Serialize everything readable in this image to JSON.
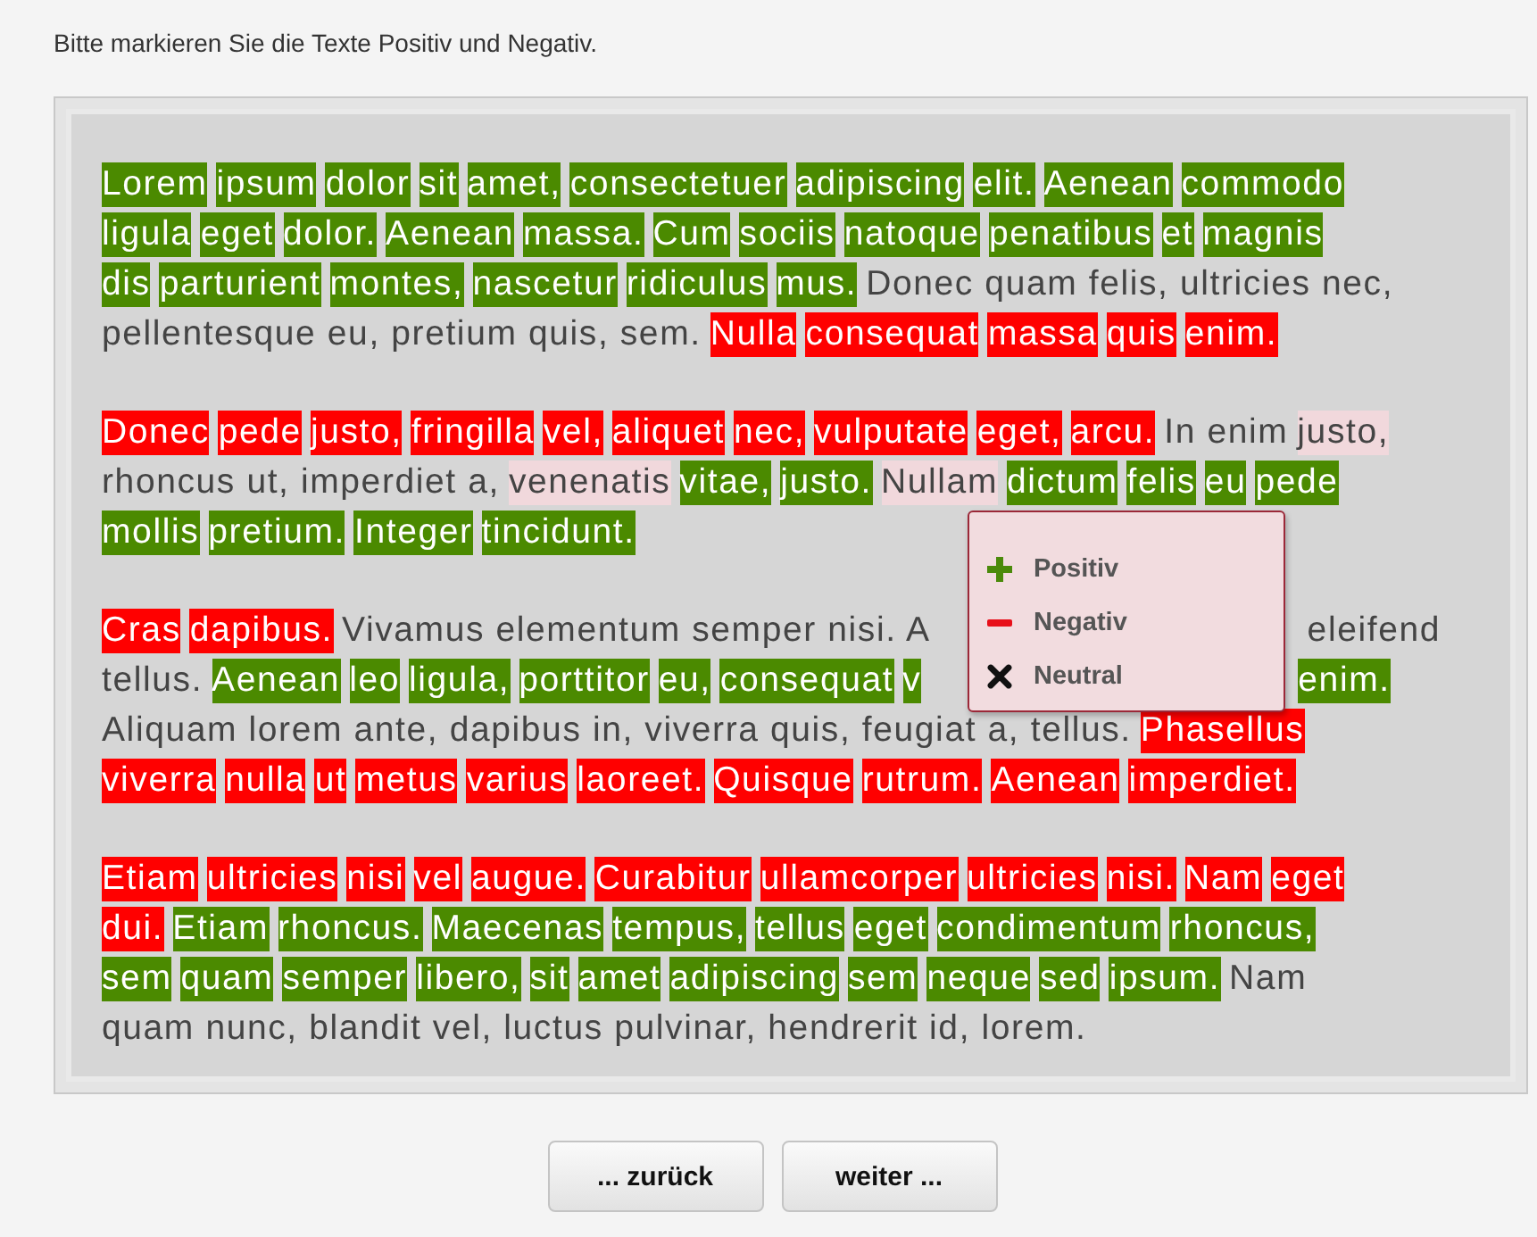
{
  "instruction": "Bitte markieren Sie die Texte Positiv und Negativ.",
  "paragraphs": [
    [
      [
        {
          "text": "Lorem ipsum dolor sit amet, consectetuer adipiscing elit. Aenean commodo",
          "kind": "positive"
        }
      ],
      [
        {
          "text": "ligula eget dolor. Aenean massa. Cum sociis natoque penatibus et magnis",
          "kind": "positive"
        }
      ],
      [
        {
          "text": "dis parturient montes, nascetur ridiculus mus.",
          "kind": "positive"
        },
        {
          "text": "Donec quam felis, ultricies nec,",
          "kind": "neutral"
        }
      ],
      [
        {
          "text": "pellentesque eu, pretium quis, sem.",
          "kind": "neutral"
        },
        {
          "text": "Nulla consequat massa quis enim.",
          "kind": "negative"
        }
      ]
    ],
    [
      [
        {
          "text": "Donec pede justo, fringilla vel, aliquet nec, vulputate eget, arcu.",
          "kind": "negative"
        },
        {
          "text": "In enim",
          "kind": "neutral"
        },
        {
          "text": "justo,",
          "kind": "pending"
        }
      ],
      [
        {
          "text": "rhoncus ut, imperdiet a,",
          "kind": "neutral"
        },
        {
          "text": "venenatis",
          "kind": "pending"
        },
        {
          "text": "vitae, justo.",
          "kind": "positive"
        },
        {
          "text": "Nullam",
          "kind": "pending"
        },
        {
          "text": "dictum felis eu pede",
          "kind": "positive"
        }
      ],
      [
        {
          "text": "mollis pretium. Integer tincidunt.",
          "kind": "positive"
        }
      ]
    ],
    [
      [
        {
          "text": "Cras dapibus.",
          "kind": "negative"
        },
        {
          "text": "Vivamus elementum semper nisi. A",
          "kind": "neutral",
          "covered_after": true
        },
        {
          "text": "eleifend",
          "kind": "neutral"
        }
      ],
      [
        {
          "text": "tellus.",
          "kind": "neutral"
        },
        {
          "text": "Aenean leo ligula, porttitor eu, consequat v",
          "kind": "positive",
          "covered_after": true
        },
        {
          "text": "enim.",
          "kind": "positive"
        }
      ],
      [
        {
          "text": "Aliquam lorem ante, dapibus in, viverra quis, feugiat a, tellus.",
          "kind": "neutral"
        },
        {
          "text": "Phasellus",
          "kind": "negative"
        }
      ],
      [
        {
          "text": "viverra nulla ut metus varius laoreet. Quisque rutrum. Aenean imperdiet.",
          "kind": "negative"
        }
      ]
    ],
    [
      [
        {
          "text": "Etiam ultricies nisi vel augue. Curabitur ullamcorper ultricies nisi. Nam eget",
          "kind": "negative"
        }
      ],
      [
        {
          "text": "dui.",
          "kind": "negative"
        },
        {
          "text": "Etiam rhoncus. Maecenas tempus, tellus eget condimentum rhoncus,",
          "kind": "positive"
        }
      ],
      [
        {
          "text": "sem quam semper libero, sit amet adipiscing sem neque sed ipsum.",
          "kind": "positive"
        },
        {
          "text": "Nam",
          "kind": "neutral"
        }
      ],
      [
        {
          "text": "quam nunc, blandit vel, luctus pulvinar, hendrerit id, lorem.",
          "kind": "neutral"
        }
      ]
    ]
  ],
  "menu": [
    {
      "label": "Positiv",
      "kind": "positive"
    },
    {
      "label": "Negativ",
      "kind": "negative"
    },
    {
      "label": "Neutral",
      "kind": "neutral"
    }
  ],
  "buttons": [
    "... zurück",
    "weiter ..."
  ]
}
